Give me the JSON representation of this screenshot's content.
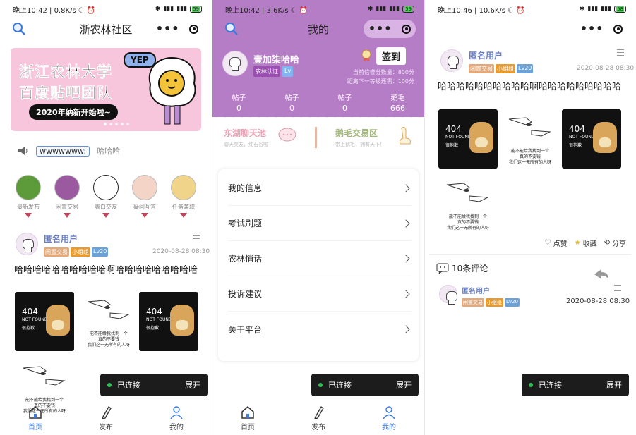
{
  "status": {
    "p1": {
      "time": "晚上10:42",
      "speed": "0.8K/s"
    },
    "p2": {
      "time": "晚上10:42",
      "speed": "3.6K/s"
    },
    "p3": {
      "time": "晚上10:46",
      "speed": "10.6K/s"
    },
    "battery": "59",
    "battery3": "58"
  },
  "home": {
    "title": "浙农林社区",
    "banner": {
      "line1": "浙江农林大学",
      "line2": "百度贴吧团队",
      "sub": "2020年纳新开始啦~",
      "yep": "YEP"
    },
    "notice": {
      "tag": "wwwwwww:",
      "text": "哈哈哈"
    },
    "categories": [
      {
        "label": "最新发布",
        "color": "#5d9a3a"
      },
      {
        "label": "闲置交易",
        "color": "#9b5aa0"
      },
      {
        "label": "表白交友",
        "color": "#ffffff"
      },
      {
        "label": "疑问互答",
        "color": "#f3d4c6"
      },
      {
        "label": "任务兼职",
        "color": "#f0d48a"
      }
    ]
  },
  "post": {
    "user": "匿名用户",
    "badges": [
      "闲置交易",
      "小组组",
      "Lv20"
    ],
    "date": "2020-08-28 08:30",
    "content": "哈哈哈哈哈哈哈哈哈哈啊哈哈哈哈哈哈哈哈哈",
    "img404": {
      "code": "404",
      "nf": "NOT FOUND",
      "cn": "很抱歉"
    },
    "sketch_caption": "能不能给我找到一个\n真的不要钱\n我们这一无所有的人呀"
  },
  "toast": {
    "status": "已连接",
    "action": "展开"
  },
  "tabs": [
    {
      "label": "首页"
    },
    {
      "label": "发布"
    },
    {
      "label": "我的"
    }
  ],
  "mine": {
    "title": "我的",
    "name": "壹加柒哈哈",
    "tags": [
      "农林认证",
      "Lv"
    ],
    "checkin": "签到",
    "points": "当前信誉分数量：800分",
    "next": "距离下一等级还需：100分",
    "stats": [
      {
        "label": "帖子",
        "value": "0"
      },
      {
        "label": "帖子",
        "value": "0"
      },
      {
        "label": "帖子",
        "value": "0"
      },
      {
        "label": "鹅毛",
        "value": "666"
      }
    ],
    "feature1": {
      "title": "东湖聊天池",
      "desc": "聊天交友，红石谷啦"
    },
    "feature2": {
      "title": "鹅毛交易区",
      "desc": "带上鹅毛，拥有天下！"
    },
    "menu": [
      "我的信息",
      "考试刷题",
      "农林悄话",
      "投诉建议",
      "关于平台"
    ]
  },
  "detail": {
    "actions": [
      "点赞",
      "收藏",
      "分享"
    ],
    "comments": "10条评论",
    "comment": {
      "user": "匿名用户",
      "badges": [
        "闲置交易",
        "小组组",
        "Lv20"
      ],
      "date": "2020-08-28 08:30"
    }
  },
  "colors": {
    "accent": "#3b7be0",
    "purple": "#b57dc6",
    "feature1": "#e7a3b4",
    "feature2": "#a4b97d"
  }
}
